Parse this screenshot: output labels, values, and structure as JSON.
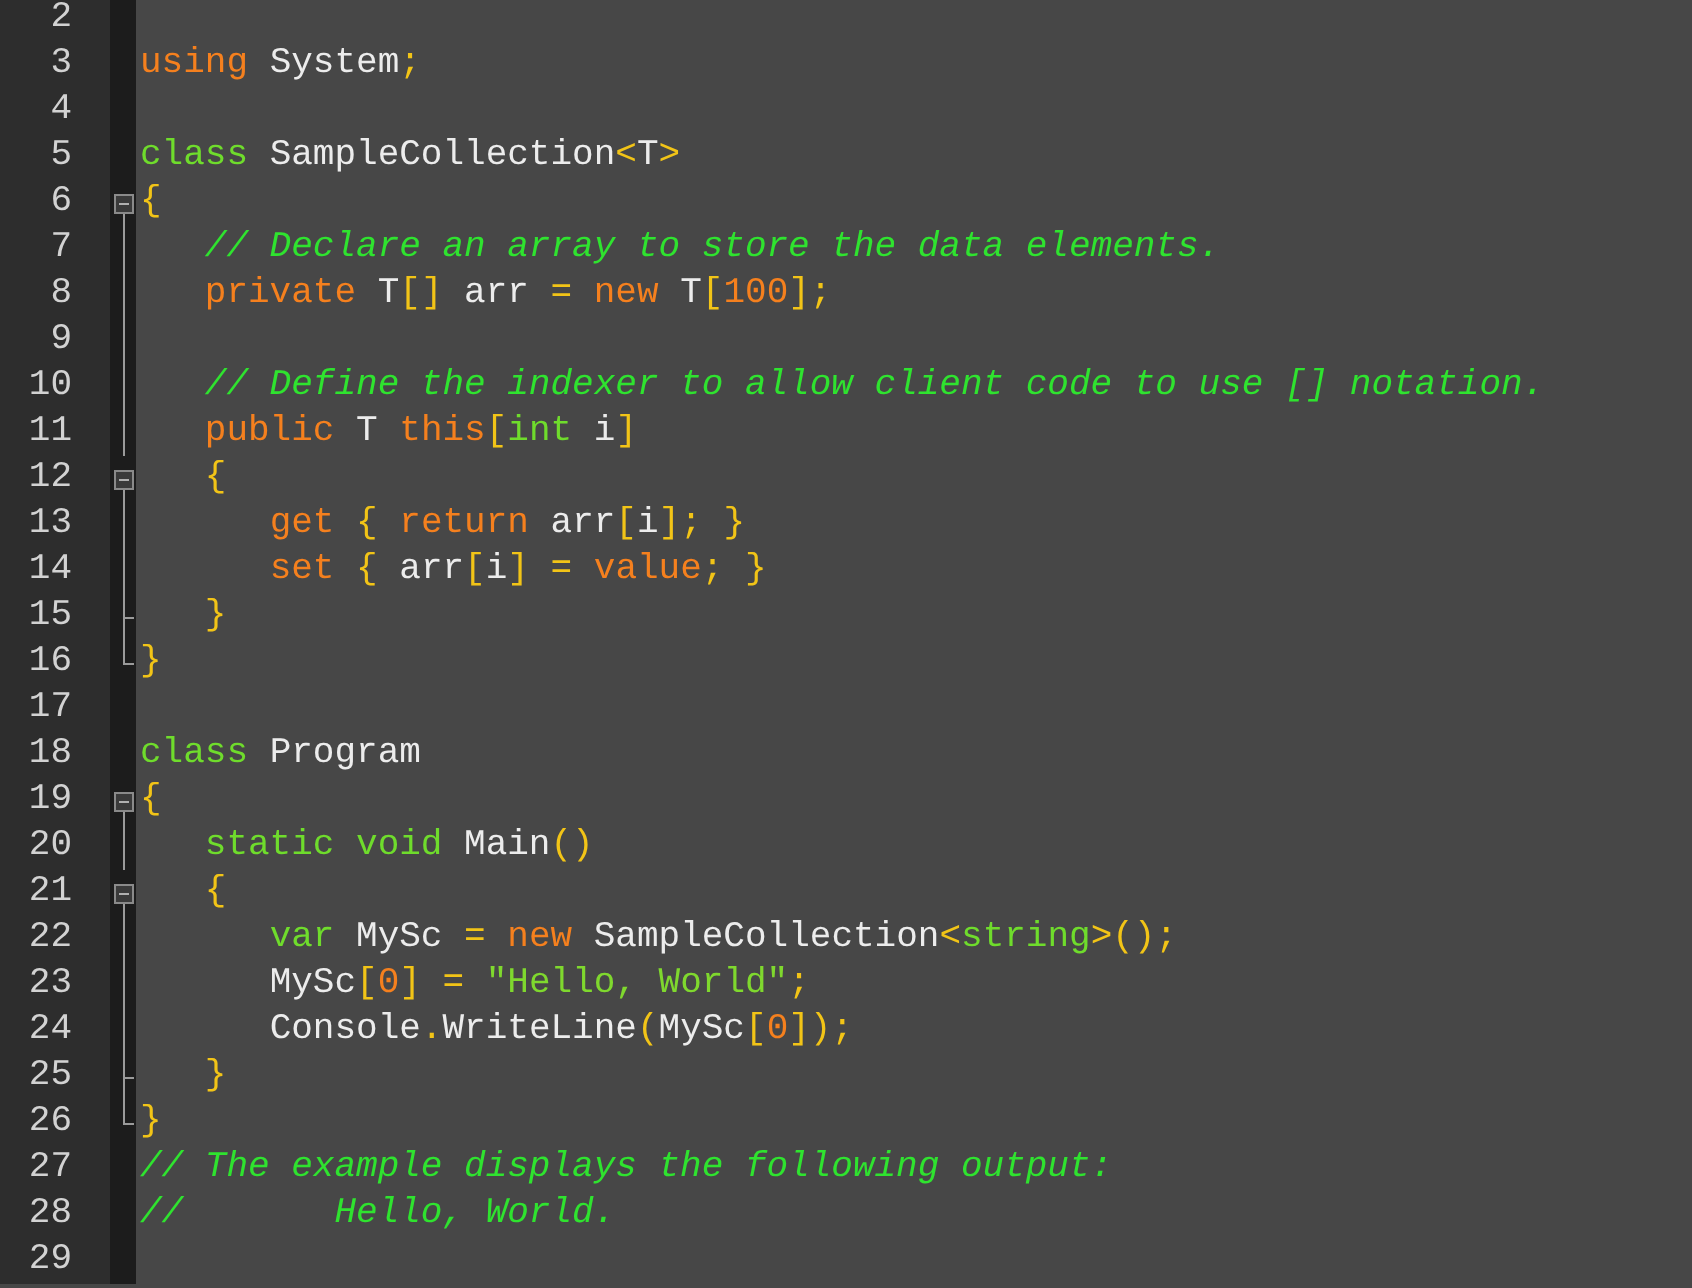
{
  "editor": {
    "lines": [
      {
        "number": "2",
        "kind": "plain"
      },
      {
        "number": "3",
        "kind": "plain",
        "tokens": [
          {
            "text": "using ",
            "kind": "kw"
          },
          {
            "text": "System",
            "kind": "id"
          },
          {
            "text": ";",
            "kind": "punct"
          }
        ]
      },
      {
        "number": "4",
        "kind": "plain"
      },
      {
        "number": "5",
        "kind": "plain",
        "tokens": [
          {
            "text": "class ",
            "kind": "type"
          },
          {
            "text": "SampleCollection",
            "kind": "id"
          },
          {
            "text": "<",
            "kind": "punct"
          },
          {
            "text": "T",
            "kind": "id"
          },
          {
            "text": ">",
            "kind": "punct"
          }
        ]
      },
      {
        "number": "6",
        "kind": "fold-start",
        "expanded": true,
        "tokens": [
          {
            "text": "{",
            "kind": "punct"
          }
        ]
      },
      {
        "number": "7",
        "kind": "fold-inner",
        "tokens": [
          {
            "text": "   // Declare an array to store the data elements.",
            "kind": "comment"
          }
        ]
      },
      {
        "number": "8",
        "kind": "fold-inner",
        "tokens": [
          {
            "text": "   private ",
            "kind": "kw"
          },
          {
            "text": "T",
            "kind": "id"
          },
          {
            "text": "[]",
            "kind": "punct"
          },
          {
            "text": " arr ",
            "kind": "id"
          },
          {
            "text": "= ",
            "kind": "punct"
          },
          {
            "text": "new ",
            "kind": "kw"
          },
          {
            "text": "T",
            "kind": "id"
          },
          {
            "text": "[",
            "kind": "punct"
          },
          {
            "text": "100",
            "kind": "num"
          },
          {
            "text": "];",
            "kind": "punct"
          }
        ]
      },
      {
        "number": "9",
        "kind": "fold-inner"
      },
      {
        "number": "10",
        "kind": "fold-inner",
        "tokens": [
          {
            "text": "   // Define the indexer to allow client code to use [] notation.",
            "kind": "comment"
          }
        ]
      },
      {
        "number": "11",
        "kind": "fold-inner",
        "tokens": [
          {
            "text": "   public ",
            "kind": "kw"
          },
          {
            "text": "T ",
            "kind": "id"
          },
          {
            "text": "this",
            "kind": "kw"
          },
          {
            "text": "[",
            "kind": "punct"
          },
          {
            "text": "int ",
            "kind": "type"
          },
          {
            "text": "i",
            "kind": "id"
          },
          {
            "text": "]",
            "kind": "punct"
          }
        ]
      },
      {
        "number": "12",
        "kind": "fold-start",
        "expanded": true,
        "tokens": [
          {
            "text": "   {",
            "kind": "punct"
          }
        ]
      },
      {
        "number": "13",
        "kind": "fold-inner",
        "tokens": [
          {
            "text": "      get ",
            "kind": "kw"
          },
          {
            "text": "{ ",
            "kind": "punct"
          },
          {
            "text": "return ",
            "kind": "kw"
          },
          {
            "text": "arr",
            "kind": "id"
          },
          {
            "text": "[",
            "kind": "punct"
          },
          {
            "text": "i",
            "kind": "id"
          },
          {
            "text": "]; }",
            "kind": "punct"
          }
        ]
      },
      {
        "number": "14",
        "kind": "fold-inner",
        "tokens": [
          {
            "text": "      set ",
            "kind": "kw"
          },
          {
            "text": "{ ",
            "kind": "punct"
          },
          {
            "text": "arr",
            "kind": "id"
          },
          {
            "text": "[",
            "kind": "punct"
          },
          {
            "text": "i",
            "kind": "id"
          },
          {
            "text": "] = ",
            "kind": "punct"
          },
          {
            "text": "value",
            "kind": "kw"
          },
          {
            "text": "; }",
            "kind": "punct"
          }
        ]
      },
      {
        "number": "15",
        "kind": "fold-close",
        "tokens": [
          {
            "text": "   }",
            "kind": "punct"
          }
        ]
      },
      {
        "number": "16",
        "kind": "fold-end",
        "tokens": [
          {
            "text": "}",
            "kind": "punct"
          }
        ]
      },
      {
        "number": "17",
        "kind": "plain"
      },
      {
        "number": "18",
        "kind": "plain",
        "tokens": [
          {
            "text": "class ",
            "kind": "type"
          },
          {
            "text": "Program",
            "kind": "id"
          }
        ]
      },
      {
        "number": "19",
        "kind": "fold-start",
        "expanded": true,
        "tokens": [
          {
            "text": "{",
            "kind": "punct"
          }
        ]
      },
      {
        "number": "20",
        "kind": "fold-inner",
        "tokens": [
          {
            "text": "   static void ",
            "kind": "type"
          },
          {
            "text": "Main",
            "kind": "id"
          },
          {
            "text": "()",
            "kind": "punct"
          }
        ]
      },
      {
        "number": "21",
        "kind": "fold-start",
        "expanded": true,
        "tokens": [
          {
            "text": "   {",
            "kind": "punct"
          }
        ]
      },
      {
        "number": "22",
        "kind": "fold-inner",
        "tokens": [
          {
            "text": "      var ",
            "kind": "type"
          },
          {
            "text": "MySc ",
            "kind": "id"
          },
          {
            "text": "= ",
            "kind": "punct"
          },
          {
            "text": "new ",
            "kind": "kw"
          },
          {
            "text": "SampleCollection",
            "kind": "id"
          },
          {
            "text": "<",
            "kind": "punct"
          },
          {
            "text": "string",
            "kind": "type"
          },
          {
            "text": ">();",
            "kind": "punct"
          }
        ]
      },
      {
        "number": "23",
        "kind": "fold-inner",
        "tokens": [
          {
            "text": "      MySc",
            "kind": "id"
          },
          {
            "text": "[",
            "kind": "punct"
          },
          {
            "text": "0",
            "kind": "num"
          },
          {
            "text": "] = ",
            "kind": "punct"
          },
          {
            "text": "\"Hello, World\"",
            "kind": "str"
          },
          {
            "text": ";",
            "kind": "punct"
          }
        ]
      },
      {
        "number": "24",
        "kind": "fold-inner",
        "tokens": [
          {
            "text": "      Console",
            "kind": "id"
          },
          {
            "text": ".",
            "kind": "punct"
          },
          {
            "text": "WriteLine",
            "kind": "id"
          },
          {
            "text": "(",
            "kind": "punct"
          },
          {
            "text": "MySc",
            "kind": "id"
          },
          {
            "text": "[",
            "kind": "punct"
          },
          {
            "text": "0",
            "kind": "num"
          },
          {
            "text": "]);",
            "kind": "punct"
          }
        ]
      },
      {
        "number": "25",
        "kind": "fold-close",
        "tokens": [
          {
            "text": "   }",
            "kind": "punct"
          }
        ]
      },
      {
        "number": "26",
        "kind": "fold-end",
        "tokens": [
          {
            "text": "}",
            "kind": "punct"
          }
        ]
      },
      {
        "number": "27",
        "kind": "plain",
        "tokens": [
          {
            "text": "// The example displays the following output:",
            "kind": "comment"
          }
        ]
      },
      {
        "number": "28",
        "kind": "plain",
        "tokens": [
          {
            "text": "//       Hello, World.",
            "kind": "comment"
          }
        ]
      },
      {
        "number": "29",
        "kind": "plain"
      }
    ]
  }
}
